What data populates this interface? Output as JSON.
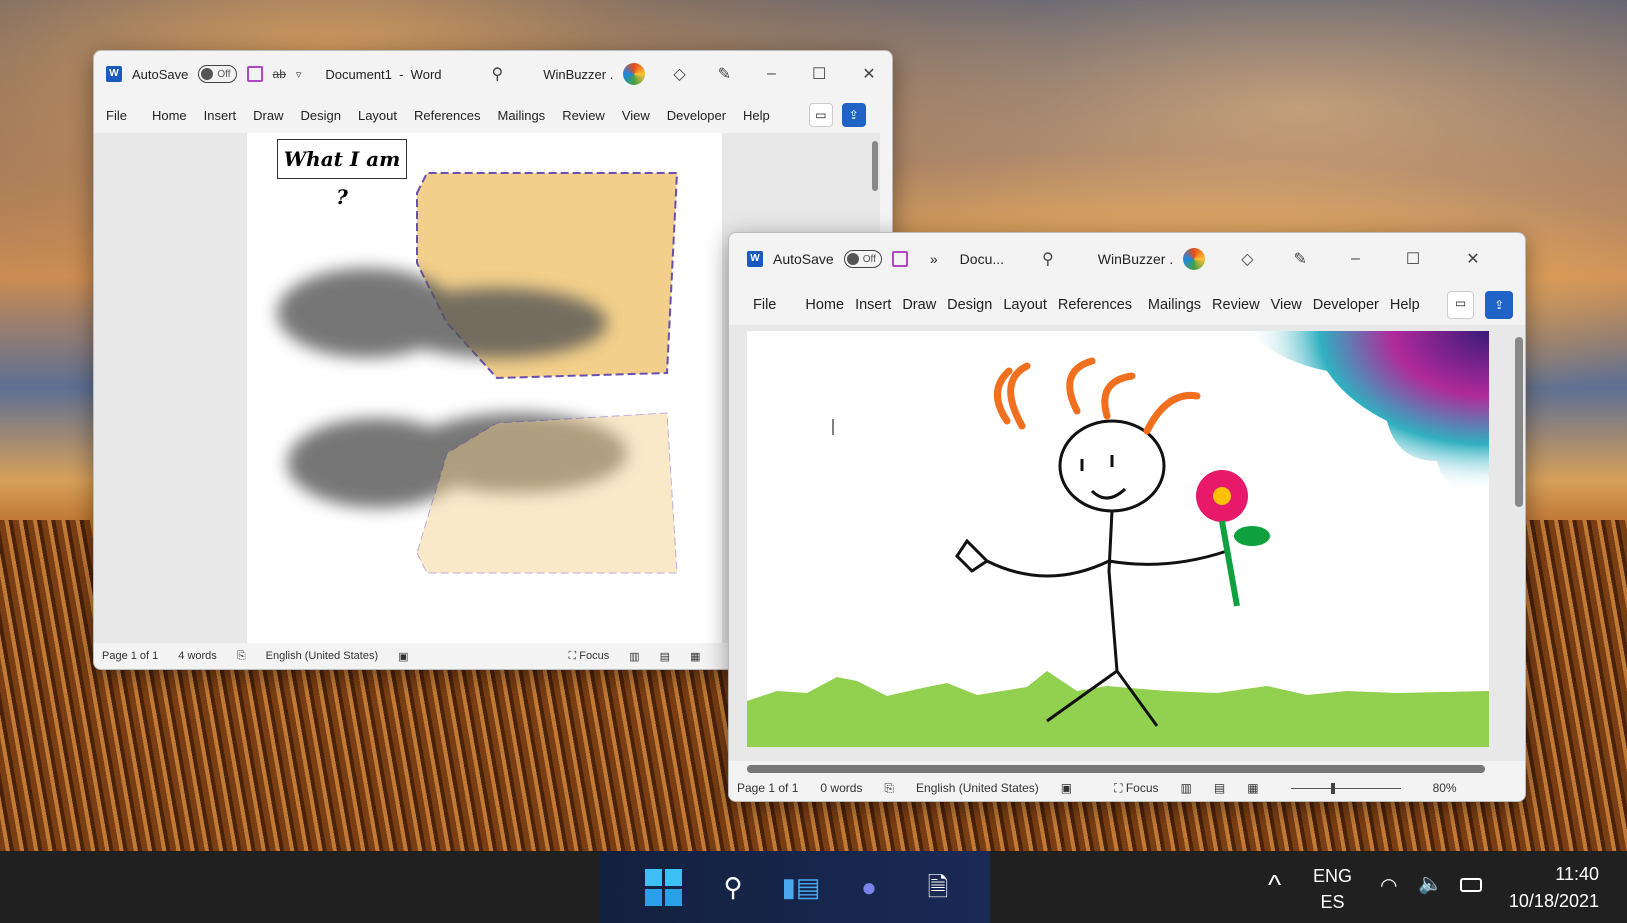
{
  "window1": {
    "app_label": "W",
    "autosave": "AutoSave",
    "toggle": "Off",
    "title": "Document1  -  Word",
    "account": "WinBuzzer .",
    "tabs": [
      "File",
      "Home",
      "Insert",
      "Draw",
      "Design",
      "Layout",
      "References",
      "Mailings",
      "Review",
      "View",
      "Developer",
      "Help"
    ],
    "doc_text": "What I am ?",
    "status": {
      "page": "Page 1 of 1",
      "words": "4 words",
      "language": "English (United States)",
      "focus": "Focus"
    }
  },
  "window2": {
    "app_label": "W",
    "autosave": "AutoSave",
    "toggle": "Off",
    "more": "»",
    "title": "Docu...",
    "account": "WinBuzzer .",
    "tabs": [
      "File",
      "Home",
      "Insert",
      "Draw",
      "Design",
      "Layout",
      "References",
      "Mailings",
      "Review",
      "View",
      "Developer",
      "Help"
    ],
    "status": {
      "page": "Page 1 of 1",
      "words": "0 words",
      "language": "English (United States)",
      "focus": "Focus",
      "zoom": "80%"
    },
    "zoom_level": 80
  },
  "taskbar": {
    "lang1": "ENG",
    "lang2": "ES",
    "time": "11:40",
    "date": "10/18/2021"
  }
}
